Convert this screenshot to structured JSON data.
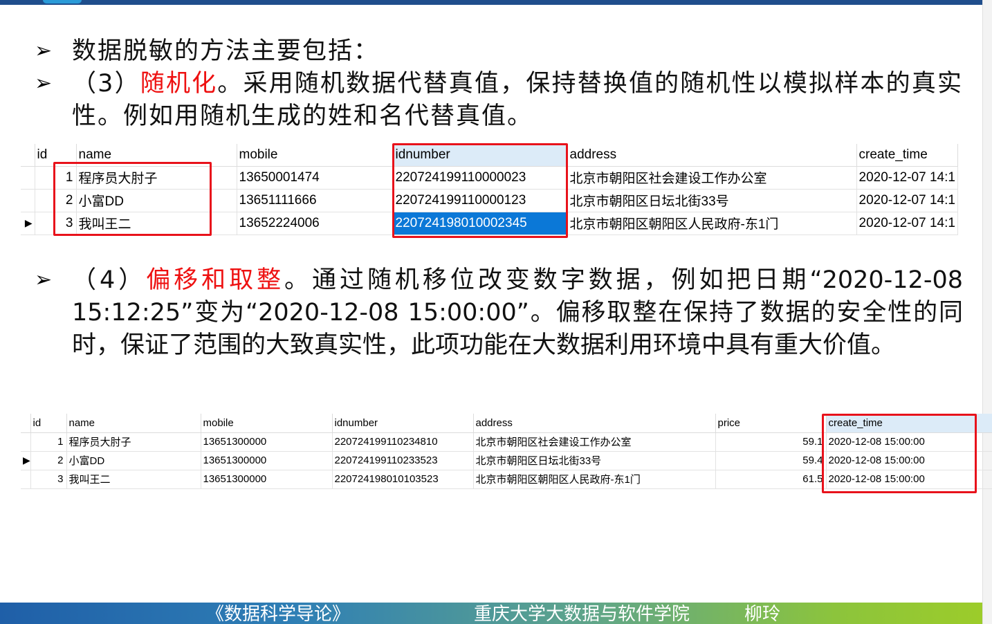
{
  "bullets": {
    "intro": "数据脱敏的方法主要包括：",
    "b3": {
      "prefix": "（3）",
      "highlight": "随机化",
      "text": "。采用随机数据代替真值，保持替换值的随机性以模拟样本的真实性。例如用随机生成的姓和名代替真值。"
    },
    "b4": {
      "prefix": "（4）",
      "highlight": "偏移和取整",
      "text": "。通过随机移位改变数字数据，例如把日期“2020-12-08 15:12:25”变为“2020-12-08  15:00:00”。偏移取整在保持了数据的安全性的同时，保证了范围的大致真实性，此项功能在大数据利用环境中具有重大价值。"
    }
  },
  "table1": {
    "columns": [
      "id",
      "name",
      "mobile",
      "idnumber",
      "address",
      "create_time"
    ],
    "rows": [
      {
        "marker": "",
        "id": "1",
        "name": "程序员大肘子",
        "mobile": "13650001474",
        "idnumber": "220724199110000023",
        "address": "北京市朝阳区社会建设工作办公室",
        "create_time": "2020-12-07 14:1"
      },
      {
        "marker": "",
        "id": "2",
        "name": "小富DD",
        "mobile": "13651111666",
        "idnumber": "220724199110000123",
        "address": "北京市朝阳区日坛北街33号",
        "create_time": "2020-12-07 14:1"
      },
      {
        "marker": "▶",
        "id": "3",
        "name": "我叫王二",
        "mobile": "13652224006",
        "idnumber": "220724198010002345",
        "address": "北京市朝阳区朝阳区人民政府-东1门",
        "create_time": "2020-12-07 14:1"
      }
    ]
  },
  "table2": {
    "columns": [
      "id",
      "name",
      "mobile",
      "idnumber",
      "address",
      "price",
      "create_time"
    ],
    "rows": [
      {
        "marker": "",
        "id": "1",
        "name": "程序员大肘子",
        "mobile": "13651300000",
        "idnumber": "220724199110234810",
        "address": "北京市朝阳区社会建设工作办公室",
        "price": "59.1",
        "create_time": "2020-12-08 15:00:00"
      },
      {
        "marker": "▶",
        "id": "2",
        "name": "小富DD",
        "mobile": "13651300000",
        "idnumber": "220724199110233523",
        "address": "北京市朝阳区日坛北街33号",
        "price": "59.4",
        "create_time": "2020-12-08 15:00:00"
      },
      {
        "marker": "",
        "id": "3",
        "name": "我叫王二",
        "mobile": "13651300000",
        "idnumber": "220724198010103523",
        "address": "北京市朝阳区朝阳区人民政府-东1门",
        "price": "61.5",
        "create_time": "2020-12-08 15:00:00"
      }
    ]
  },
  "footer": {
    "course": "《数据科学导论》",
    "school": "重庆大学大数据与软件学院",
    "author": "柳玲"
  },
  "colors": {
    "highlight": "#ee1111",
    "box": "#e8121b",
    "selection": "#0b78d7",
    "header_bar": "#1f4e8c"
  }
}
